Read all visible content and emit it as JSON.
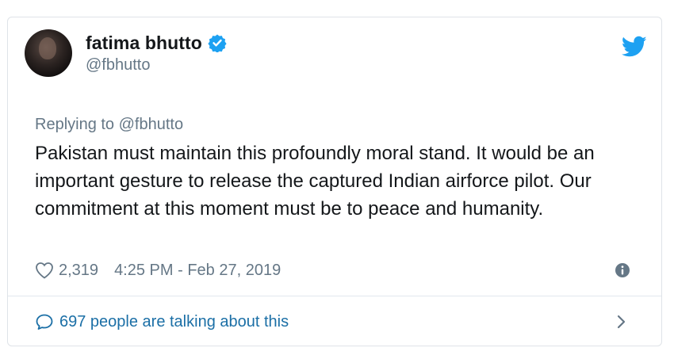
{
  "user": {
    "display_name": "fatima bhutto",
    "handle": "@fbhutto",
    "verified_icon": "verified-badge-icon",
    "avatar": "profile-photo"
  },
  "brand_icon": "twitter-bird-icon",
  "tweet": {
    "replying_to": "Replying to @fbhutto",
    "text": "Pakistan must maintain this profoundly moral stand. It would be an important gesture to release the captured Indian airforce pilot. Our commitment at this moment must be to peace and humanity.",
    "likes": "2,319",
    "timestamp": "4:25 PM - Feb 27, 2019"
  },
  "footer": {
    "talking_label": "697 people are talking about this"
  },
  "colors": {
    "brand_blue": "#1da1f2",
    "text_primary": "#14171a",
    "text_secondary": "#657786",
    "link_blue": "#1b6fa6"
  }
}
